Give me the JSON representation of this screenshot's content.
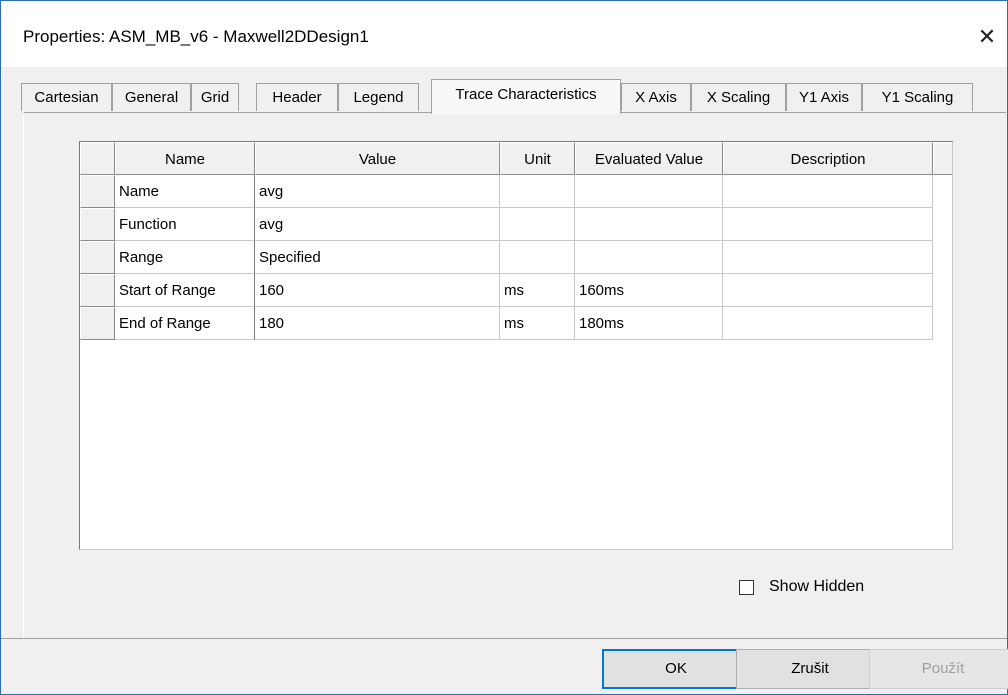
{
  "window": {
    "title": "Properties: ASM_MB_v6 - Maxwell2DDesign1",
    "close_glyph": "✕"
  },
  "tabs": [
    {
      "label": "Cartesian",
      "active": false
    },
    {
      "label": "General",
      "active": false
    },
    {
      "label": "Grid",
      "active": false
    },
    {
      "label": "Header",
      "active": false
    },
    {
      "label": "Legend",
      "active": false
    },
    {
      "label": "Trace Characteristics",
      "active": true
    },
    {
      "label": "X Axis",
      "active": false
    },
    {
      "label": "X Scaling",
      "active": false
    },
    {
      "label": "Y1 Axis",
      "active": false
    },
    {
      "label": "Y1 Scaling",
      "active": false
    }
  ],
  "table": {
    "columns": [
      "Name",
      "Value",
      "Unit",
      "Evaluated Value",
      "Description"
    ],
    "rows": [
      [
        "Name",
        "avg",
        "",
        "",
        ""
      ],
      [
        "Function",
        "avg",
        "",
        "",
        ""
      ],
      [
        "Range",
        "Specified",
        "",
        "",
        ""
      ],
      [
        "Start of Range",
        "160",
        "ms",
        "160ms",
        ""
      ],
      [
        "End of Range",
        "180",
        "ms",
        "180ms",
        ""
      ]
    ]
  },
  "show_hidden": {
    "label": "Show Hidden",
    "checked": false
  },
  "buttons": {
    "ok": "OK",
    "cancel": "Zrušit",
    "apply": "Použít"
  },
  "colors": {
    "accent": "#0078d7",
    "window_border": "#2b6cb3"
  }
}
